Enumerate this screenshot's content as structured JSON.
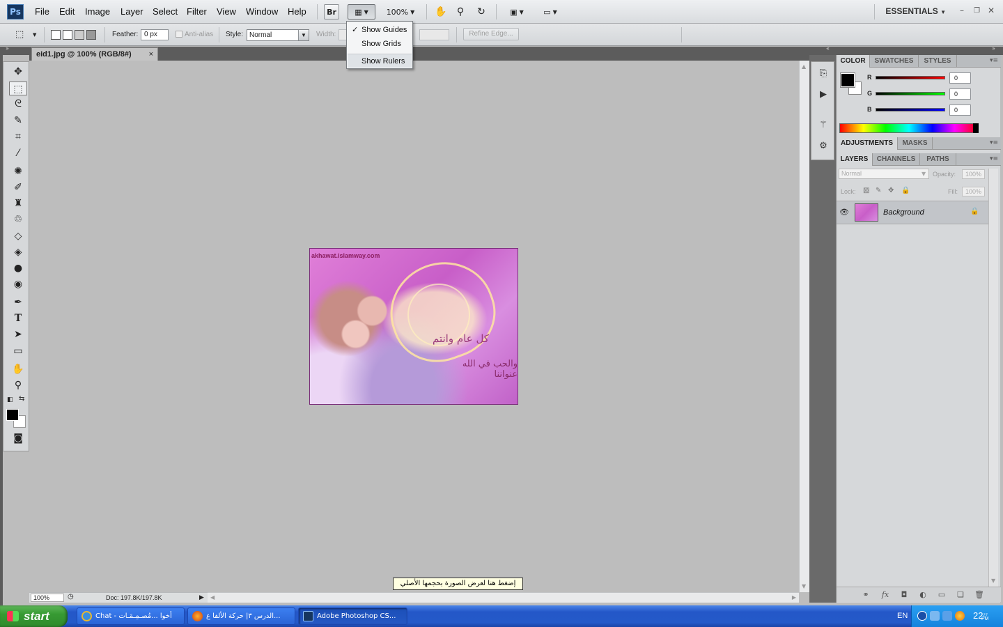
{
  "app": {
    "logo": "Ps",
    "menu": [
      "File",
      "Edit",
      "Image",
      "Layer",
      "Select",
      "Filter",
      "View",
      "Window",
      "Help"
    ],
    "bridge_label": "Br",
    "zoom_label": "100%",
    "workspace": "ESSENTIALS"
  },
  "view_extras_menu": {
    "items": [
      {
        "label": "Show Guides",
        "checked": true
      },
      {
        "label": "Show Grids",
        "checked": false
      },
      {
        "label": "Show Rulers",
        "checked": false
      }
    ]
  },
  "options": {
    "feather_label": "Feather:",
    "feather_value": "0 px",
    "antialias_label": "Anti-alias",
    "style_label": "Style:",
    "style_value": "Normal",
    "width_label": "Width:",
    "refine_edge": "Refine Edge..."
  },
  "document": {
    "tab_title": "eid1.jpg @ 100% (RGB/8#)",
    "tab_close": "×",
    "watermark": "akhawat.islamway.com",
    "art_text_1": "كل عام وانتم",
    "art_text_2": "والحب في الله عنواننا",
    "zoom_value": "100%",
    "doc_info": "Doc: 197.8K/197.8K",
    "tooltip": "إضغط هنا لعرض الصورة بحجمها الأصلي"
  },
  "color_panel": {
    "tabs": [
      "COLOR",
      "SWATCHES",
      "STYLES"
    ],
    "channels": [
      {
        "label": "R",
        "value": "0",
        "color": "#e00000"
      },
      {
        "label": "G",
        "value": "0",
        "color": "#00c000"
      },
      {
        "label": "B",
        "value": "0",
        "color": "#0000e0"
      }
    ]
  },
  "adjustments_panel": {
    "tabs": [
      "ADJUSTMENTS",
      "MASKS"
    ]
  },
  "layers_panel": {
    "tabs": [
      "LAYERS",
      "CHANNELS",
      "PATHS"
    ],
    "blend_mode": "Normal",
    "opacity_label": "Opacity:",
    "opacity_value": "100%",
    "lock_label": "Lock:",
    "fill_label": "Fill:",
    "fill_value": "100%",
    "layers": [
      {
        "name": "Background",
        "visible": true,
        "locked": true
      }
    ]
  },
  "taskbar": {
    "start": "start",
    "tasks": [
      {
        "label": "Chat - أخوا ...مُصـمِـمَـات",
        "icon": "ie-icon"
      },
      {
        "label": "الدرس ٣| حركة الألفا ع...",
        "icon": "firefox-icon"
      },
      {
        "label": "Adobe Photoshop CS...",
        "icon": "photoshop-icon"
      }
    ],
    "lang": "EN",
    "time": "22",
    "time_minutes": "27",
    "time_suffix": "PM"
  }
}
